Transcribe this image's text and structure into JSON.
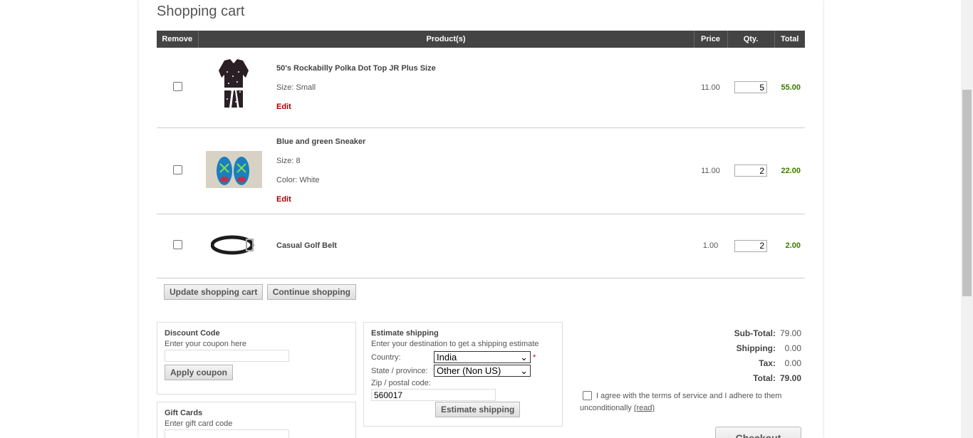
{
  "page": {
    "title": "Shopping cart"
  },
  "table": {
    "headers": {
      "remove": "Remove",
      "product": "Product(s)",
      "price": "Price",
      "qty": "Qty.",
      "total": "Total"
    },
    "rows": [
      {
        "image_icon": "polka-dot-top-image",
        "name": "50's Rockabilly Polka Dot Top JR Plus Size",
        "attr1": "Size: Small",
        "attr2": "",
        "edit": "Edit",
        "price": "11.00",
        "qty": "5",
        "total": "55.00"
      },
      {
        "image_icon": "sneaker-image",
        "name": "Blue and green Sneaker",
        "attr1": "Size: 8",
        "attr2": "Color: White",
        "edit": "Edit",
        "price": "11.00",
        "qty": "2",
        "total": "22.00"
      },
      {
        "image_icon": "belt-image",
        "name": "Casual Golf Belt",
        "price": "1.00",
        "qty": "2",
        "total": "2.00"
      }
    ]
  },
  "buttons": {
    "update": "Update shopping cart",
    "continue": "Continue shopping"
  },
  "discount": {
    "title": "Discount Code",
    "hint": "Enter your coupon here",
    "value": "",
    "button": "Apply coupon"
  },
  "giftcards": {
    "title": "Gift Cards",
    "hint": "Enter gift card code"
  },
  "shipping": {
    "title": "Estimate shipping",
    "hint": "Enter your destination to get a shipping estimate",
    "country_label": "Country:",
    "country_value": "India",
    "required_mark": "*",
    "state_label": "State / province:",
    "state_value": "Other (Non US)",
    "zip_label": "Zip / postal code:",
    "zip_value": "560017",
    "button": "Estimate shipping"
  },
  "totals": {
    "subtotal_label": "Sub-Total:",
    "subtotal": "79.00",
    "shipping_label": "Shipping:",
    "shipping": "0.00",
    "tax_label": "Tax:",
    "tax": "0.00",
    "total_label": "Total:",
    "total": "79.00"
  },
  "terms": {
    "text": "I agree with the terms of service and I adhere to them unconditionally",
    "link": "(read)"
  },
  "checkout": {
    "label": "Checkout"
  },
  "colors": {
    "header_bg": "#444444",
    "total_green": "#3a7a00",
    "edit_red": "#a40000"
  }
}
